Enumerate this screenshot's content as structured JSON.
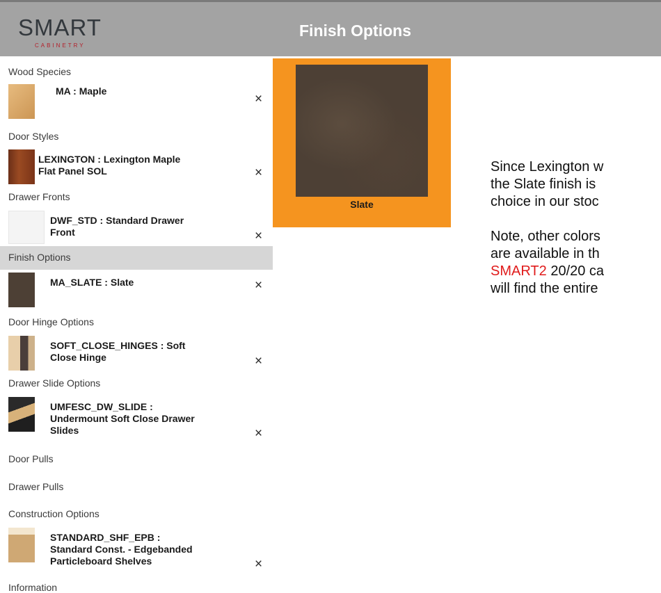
{
  "header": {
    "logo_text": "SMART",
    "logo_subtitle": "CABINETRY",
    "title": "Finish Options"
  },
  "sidebar": {
    "sections": [
      {
        "label": "Wood Species",
        "item": {
          "line1": "MA : Maple",
          "line2": ""
        }
      },
      {
        "label": "Door Styles",
        "item": {
          "line1": "LEXINGTON : Lexington Maple",
          "line2": "Flat Panel SOL"
        }
      },
      {
        "label": "Drawer Fronts",
        "item": {
          "line1": "DWF_STD : Standard Drawer",
          "line2": "Front"
        }
      },
      {
        "label": "Finish Options",
        "item": {
          "line1": "MA_SLATE : Slate",
          "line2": ""
        }
      },
      {
        "label": "Door Hinge Options",
        "item": {
          "line1": "SOFT_CLOSE_HINGES : Soft",
          "line2": "Close Hinge"
        }
      },
      {
        "label": "Drawer Slide Options",
        "item": {
          "line1": "UMFESC_DW_SLIDE :",
          "line2": "Undermount Soft Close Drawer",
          "line3": "Slides"
        }
      },
      {
        "label": "Door Pulls"
      },
      {
        "label": "Drawer Pulls"
      },
      {
        "label": "Construction Options",
        "item": {
          "line1": "STANDARD_SHF_EPB :",
          "line2": "Standard Const. - Edgebanded",
          "line3": "Particleboard Shelves"
        }
      },
      {
        "label": "Information"
      }
    ],
    "remove_glyph": "×"
  },
  "preview": {
    "label": "Slate"
  },
  "note": {
    "p1_line1": "Since Lexington w",
    "p1_line2": "the Slate finish is",
    "p1_line3": "choice in our stoc",
    "p2_line1": "Note, other colors",
    "p2_line2": "are available in th",
    "p2_line3_red": "SMART2",
    "p2_line3_rest": " 20/20 ca",
    "p2_line4": "will find the entire"
  },
  "colors": {
    "header_bg": "#a3a3a3",
    "accent_orange": "#f5941f",
    "selected_row": "#d6d6d6",
    "logo_red": "#b3202b",
    "highlight_red": "#e01b1b"
  }
}
